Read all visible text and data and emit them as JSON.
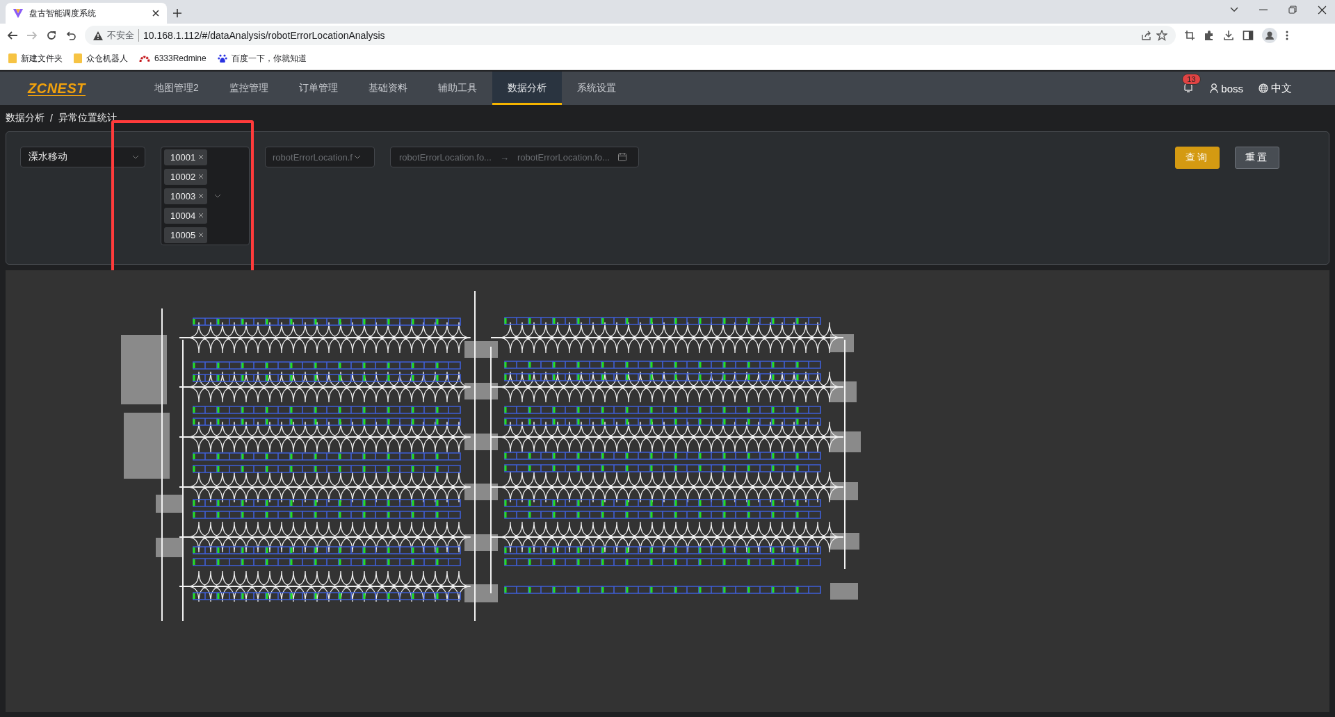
{
  "browser": {
    "tab_title": "盘古智能调度系统",
    "security_label": "不安全",
    "url": "10.168.1.112/#/dataAnalysis/robotErrorLocationAnalysis",
    "bookmarks": [
      {
        "label": "新建文件夹",
        "kind": "folder"
      },
      {
        "label": "众仓机器人",
        "kind": "folder"
      },
      {
        "label": "6333Redmine",
        "kind": "redmine"
      },
      {
        "label": "百度一下，你就知道",
        "kind": "baidu"
      }
    ]
  },
  "header": {
    "logo": "ZCNEST",
    "nav": [
      {
        "label": "地图管理2",
        "selected": false
      },
      {
        "label": "监控管理",
        "selected": false
      },
      {
        "label": "订单管理",
        "selected": false
      },
      {
        "label": "基础资料",
        "selected": false
      },
      {
        "label": "辅助工具",
        "selected": false
      },
      {
        "label": "数据分析",
        "selected": true
      },
      {
        "label": "系统设置",
        "selected": false
      }
    ],
    "notification_count": "13",
    "user": "boss",
    "language": "中文"
  },
  "breadcrumb": {
    "items": [
      "数据分析",
      "异常位置统计"
    ],
    "separator": "/"
  },
  "filters": {
    "site": "溧水移动",
    "robots": [
      "10001",
      "10002",
      "10003",
      "10004",
      "10005"
    ],
    "error_type_placeholder": "robotErrorLocation.f",
    "start_placeholder": "robotErrorLocation.fo...",
    "range_separator": "→",
    "end_placeholder": "robotErrorLocation.fo...",
    "buttons": [
      {
        "label": "查询",
        "kind": "primary"
      },
      {
        "label": "重置",
        "kind": "default"
      }
    ]
  }
}
